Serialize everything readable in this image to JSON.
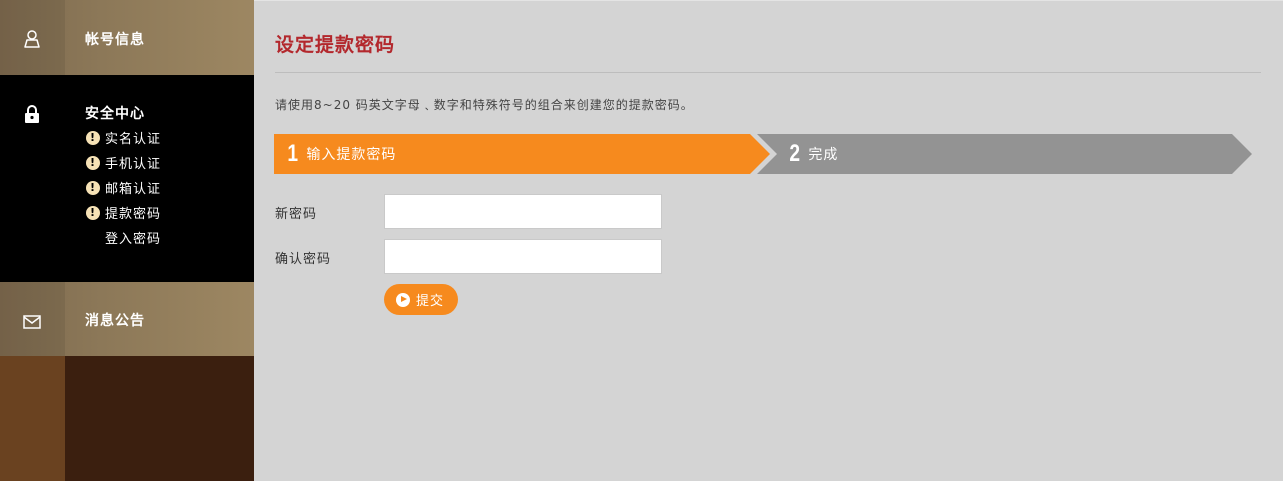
{
  "sidebar": {
    "account": {
      "label": "帐号信息",
      "icon": "user-icon"
    },
    "security": {
      "label": "安全中心",
      "icon": "lock-icon",
      "items": [
        {
          "label": "实名认证",
          "warning": true
        },
        {
          "label": "手机认证",
          "warning": true
        },
        {
          "label": "邮箱认证",
          "warning": true
        },
        {
          "label": "提款密码",
          "warning": true
        },
        {
          "label": "登入密码",
          "warning": false
        }
      ]
    },
    "messages": {
      "label": "消息公告",
      "icon": "mail-icon"
    }
  },
  "main": {
    "title": "设定提款密码",
    "hint": "请使用8~20 码英文字母﹑数字和特殊符号的组合来创建您的提款密码。",
    "steps": [
      {
        "number": "1",
        "label": "输入提款密码",
        "active": true
      },
      {
        "number": "2",
        "label": "完成",
        "active": false
      }
    ],
    "form": {
      "new_password_label": "新密码",
      "new_password_value": "",
      "confirm_password_label": "确认密码",
      "confirm_password_value": "",
      "submit_label": "提交"
    }
  },
  "colors": {
    "accent": "#f68a1e",
    "title": "#b3282d",
    "inactive_step": "#939393",
    "sidebar_dark": "#000000",
    "sidebar_brown": "#3b1f0f"
  }
}
